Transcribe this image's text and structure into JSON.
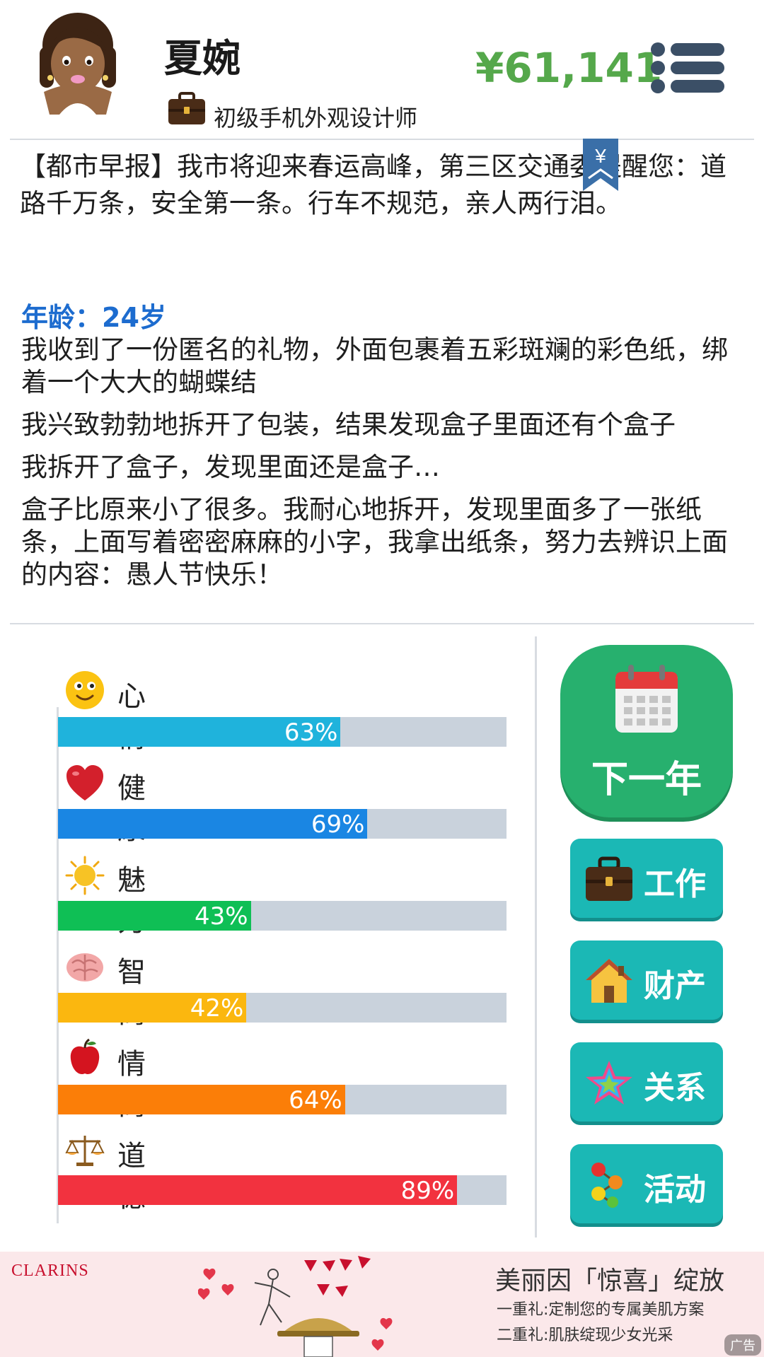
{
  "header": {
    "name": "夏婉",
    "job_title": "初级手机外观设计师",
    "money": "¥61,141"
  },
  "news": {
    "text": "【都市早报】我市将迎来春运高峰，第三区交通委提醒您：道路千万条，安全第一条。行车不规范，亲人两行泪。",
    "bookmark_symbol": "¥"
  },
  "story": {
    "age_label": "年龄：24岁",
    "paragraphs": [
      "我收到了一份匿名的礼物，外面包裹着五彩斑斓的彩色纸，绑着一个大大的蝴蝶结",
      "我兴致勃勃地拆开了包装，结果发现盒子里面还有个盒子",
      "我拆开了盒子，发现里面还是盒子…",
      "盒子比原来小了很多。我耐心地拆开，发现里面多了一张纸条，上面写着密密麻麻的小字，我拿出纸条，努力去辨识上面的内容：愚人节快乐！"
    ]
  },
  "stats": [
    {
      "label": "心情",
      "value": 63,
      "percent": "63%",
      "color": "#1fb3dc",
      "icon": "smiley-icon"
    },
    {
      "label": "健康",
      "value": 69,
      "percent": "69%",
      "color": "#1a86e3",
      "icon": "heart-icon"
    },
    {
      "label": "魅力",
      "value": 43,
      "percent": "43%",
      "color": "#0fbf55",
      "icon": "sun-icon"
    },
    {
      "label": "智商",
      "value": 42,
      "percent": "42%",
      "color": "#fbb70f",
      "icon": "brain-icon"
    },
    {
      "label": "情商",
      "value": 64,
      "percent": "64%",
      "color": "#fb7e08",
      "icon": "apple-icon"
    },
    {
      "label": "道德",
      "value": 89,
      "percent": "89%",
      "color": "#f2323f",
      "icon": "scales-icon"
    }
  ],
  "actions": {
    "next_year": "下一年",
    "work": "工作",
    "property": "财产",
    "relations": "关系",
    "activities": "活动"
  },
  "ad": {
    "brand": "CLARINS",
    "title": "美丽因「惊喜」绽放",
    "line1": "一重礼:定制您的专属美肌方案",
    "line2": "二重礼:肌肤绽现少女光采",
    "tag": "广告"
  },
  "colors": {
    "money": "#55a84b",
    "age": "#1d6ccf",
    "next_button": "#27b06e",
    "side_button": "#1bb8b5",
    "track": "#c9d2dc"
  }
}
